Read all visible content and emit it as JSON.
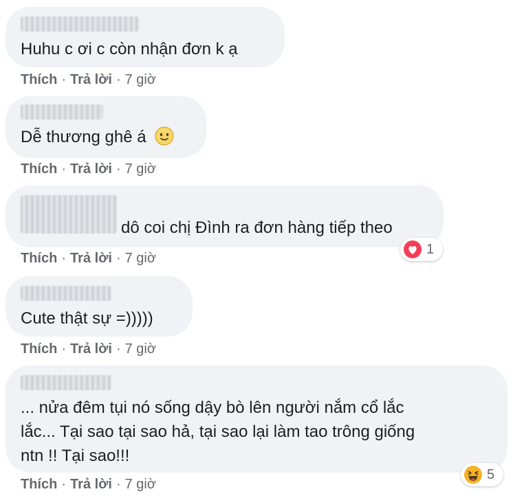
{
  "comments": [
    {
      "text_lines": [
        "Huhu c ơi c còn nhận đơn k ạ"
      ],
      "like_label": "Thích",
      "reply_label": "Trả lời",
      "time": "7 giờ"
    },
    {
      "text_lines": [
        "Dễ thương ghê á"
      ],
      "emoji": "slightly-smiling-emoji-icon",
      "like_label": "Thích",
      "reply_label": "Trả lời",
      "time": "7 giờ"
    },
    {
      "text_lines": [
        "dô coi chị Đình ra đơn hàng tiếp theo"
      ],
      "reaction": {
        "icon": "love-heart-icon",
        "count": "1"
      },
      "like_label": "Thích",
      "reply_label": "Trả lời",
      "time": "7 giờ"
    },
    {
      "text_lines": [
        "Cute thật sự =)))))"
      ],
      "like_label": "Thích",
      "reply_label": "Trả lời",
      "time": "7 giờ"
    },
    {
      "text_lines": [
        "... nửa đêm tụi nó sống dậy bò lên người nắm cổ lắc",
        "lắc... Tại sao tại sao hả, tại sao lại làm tao trông giống",
        "ntn !! Tại sao!!!"
      ],
      "reaction": {
        "icon": "laughing-haha-icon",
        "count": "5"
      },
      "like_label": "Thích",
      "reply_label": "Trả lời",
      "time": "7 giờ"
    }
  ],
  "separator": "·",
  "colors": {
    "bubble": "#f0f2f5",
    "text": "#1c1e21",
    "meta": "#65676b",
    "love": "#f33e58",
    "haha": "#f7b125"
  }
}
